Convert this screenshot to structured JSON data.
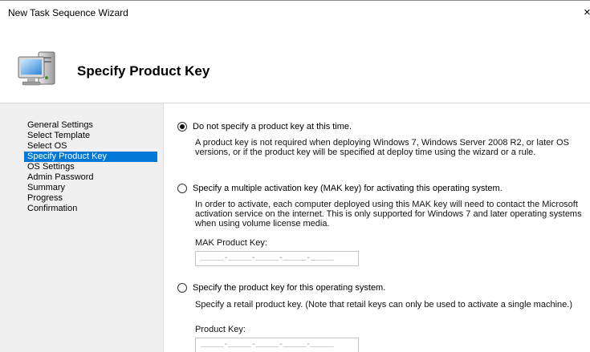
{
  "window": {
    "title": "New Task Sequence Wizard",
    "close_glyph": "×"
  },
  "header": {
    "heading": "Specify Product Key",
    "icon": "computer-wizard-icon"
  },
  "sidebar": {
    "items": [
      {
        "label": "General Settings",
        "selected": false
      },
      {
        "label": "Select Template",
        "selected": false
      },
      {
        "label": "Select OS",
        "selected": false
      },
      {
        "label": "Specify Product Key",
        "selected": true
      },
      {
        "label": "OS Settings",
        "selected": false
      },
      {
        "label": "Admin Password",
        "selected": false
      },
      {
        "label": "Summary",
        "selected": false
      },
      {
        "label": "Progress",
        "selected": false
      },
      {
        "label": "Confirmation",
        "selected": false
      }
    ]
  },
  "main": {
    "option_none": {
      "label": "Do not specify a product key at this time.",
      "selected": true,
      "description": "A product key is not required when deploying Windows 7, Windows Server 2008 R2, or later OS versions, or if the product key will be specified at deploy time using the wizard or a rule."
    },
    "option_mak": {
      "label": "Specify a multiple activation key (MAK key) for activating this operating system.",
      "selected": false,
      "description": "In order to activate, each computer deployed using this MAK key will need to contact the Microsoft activation service on the internet.  This is only supported for Windows 7 and later operating systems when using volume license media.",
      "field_label": "MAK Product Key:",
      "field_value": "_____-_____-_____-_____-_____"
    },
    "option_retail": {
      "label": "Specify the product key for this operating system.",
      "selected": false,
      "description": "Specify a retail product key.  (Note that retail keys can only be used to activate a single machine.)",
      "field_label": "Product Key:",
      "field_value": "_____-_____-_____-_____-_____"
    }
  },
  "colors": {
    "selection": "#0078d7",
    "sidebar_bg": "#f0f0f0"
  }
}
